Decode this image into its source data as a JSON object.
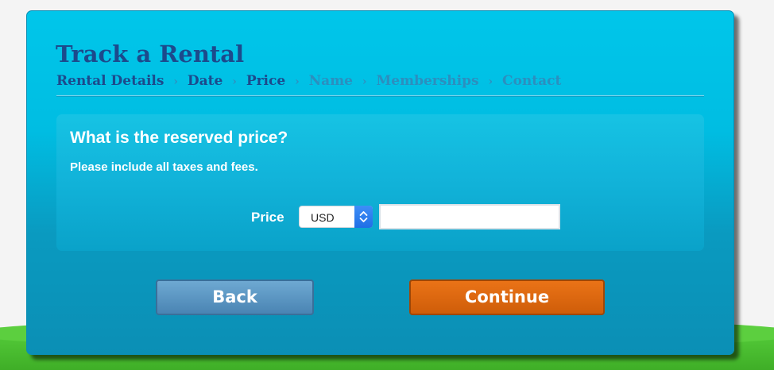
{
  "page": {
    "title": "Track a Rental",
    "breadcrumb": [
      {
        "label": "Rental Details",
        "state": "active"
      },
      {
        "label": "Date",
        "state": "active"
      },
      {
        "label": "Price",
        "state": "active"
      },
      {
        "label": "Name",
        "state": "inactive"
      },
      {
        "label": "Memberships",
        "state": "inactive"
      },
      {
        "label": "Contact",
        "state": "inactive"
      }
    ],
    "separator": "›"
  },
  "form": {
    "question": "What is the reserved price?",
    "hint": "Please include all taxes and fees.",
    "price_label": "Price",
    "currency": {
      "selected": "USD",
      "icon": "select-stepper-icon"
    },
    "price_input": {
      "value": "",
      "placeholder": ""
    }
  },
  "buttons": {
    "back_label": "Back",
    "continue_label": "Continue"
  },
  "colors": {
    "panel": "#00c6ea",
    "title": "#1c4a8c",
    "crumb_inactive": "#2b8fbf",
    "back_button": "#5f98c4",
    "continue_button": "#df6810",
    "grass": "#55cc3a"
  }
}
